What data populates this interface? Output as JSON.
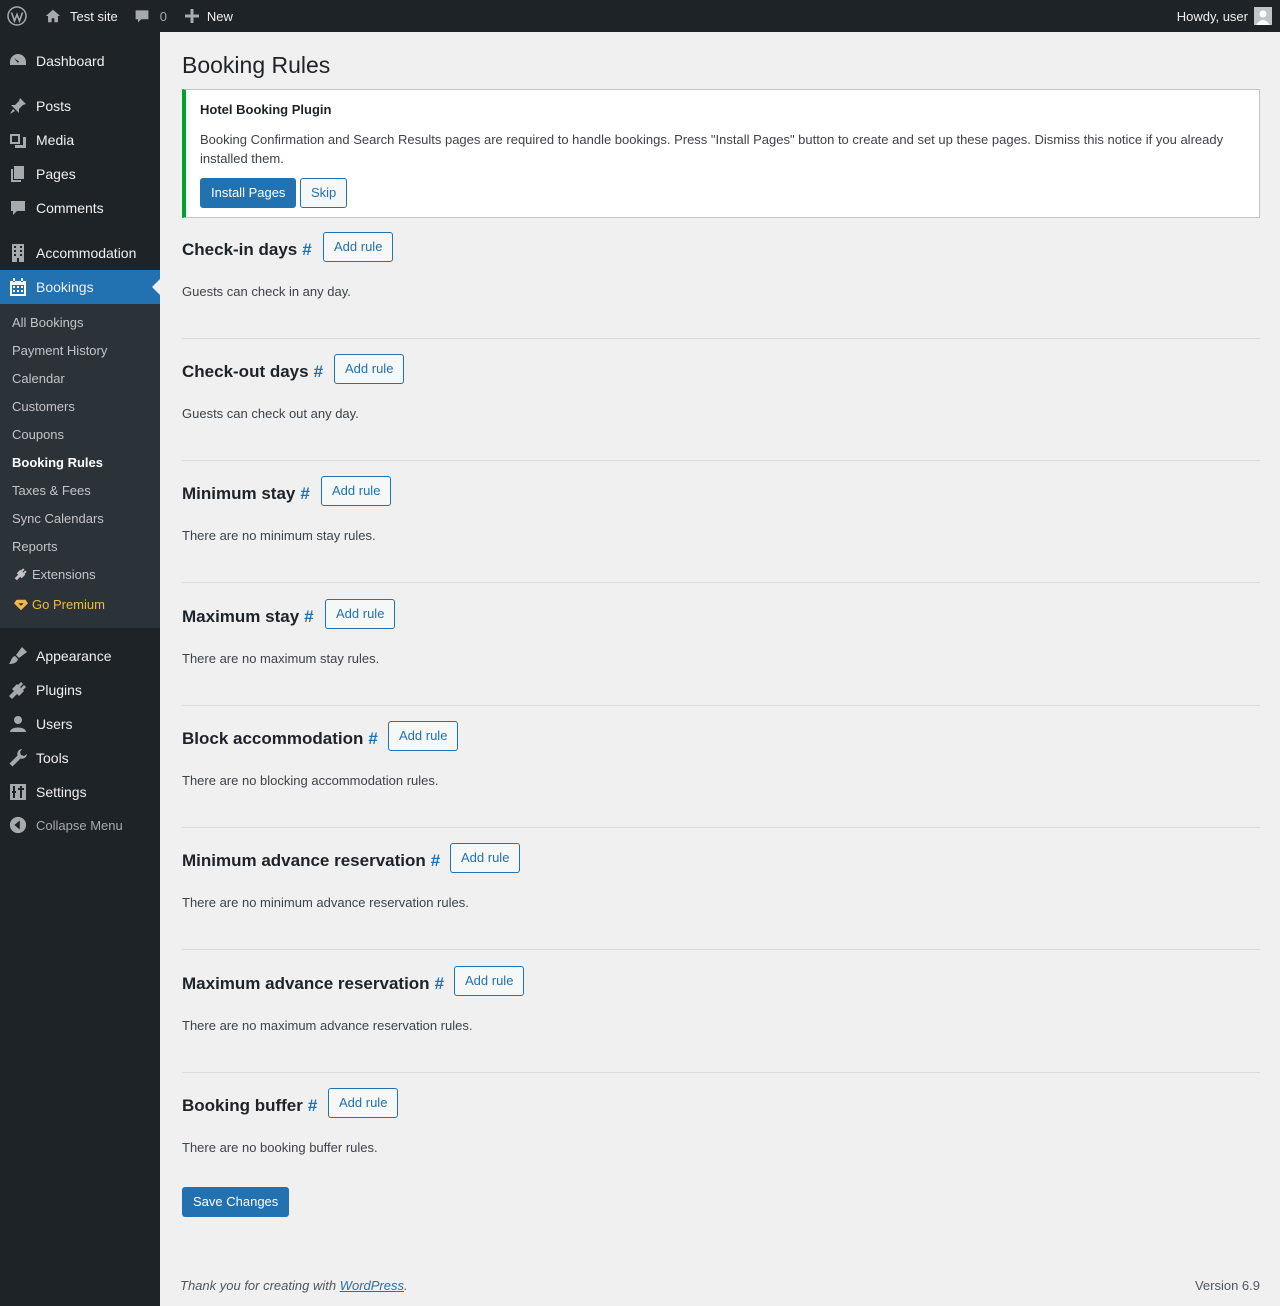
{
  "adminbar": {
    "site_name": "Test site",
    "comments_count": "0",
    "new_label": "New",
    "howdy": "Howdy, user"
  },
  "sidebar": {
    "items": [
      {
        "label": "Dashboard",
        "icon": "dashboard-icon"
      },
      {
        "label": "Posts",
        "icon": "pin-icon"
      },
      {
        "label": "Media",
        "icon": "media-icon"
      },
      {
        "label": "Pages",
        "icon": "pages-icon"
      },
      {
        "label": "Comments",
        "icon": "comment-icon"
      },
      {
        "label": "Accommodation",
        "icon": "building-icon"
      },
      {
        "label": "Bookings",
        "icon": "calendar-icon"
      },
      {
        "label": "Appearance",
        "icon": "brush-icon"
      },
      {
        "label": "Plugins",
        "icon": "plug-icon"
      },
      {
        "label": "Users",
        "icon": "user-icon"
      },
      {
        "label": "Tools",
        "icon": "wrench-icon"
      },
      {
        "label": "Settings",
        "icon": "settings-icon"
      }
    ],
    "submenu": [
      "All Bookings",
      "Payment History",
      "Calendar",
      "Customers",
      "Coupons",
      "Booking Rules",
      "Taxes & Fees",
      "Sync Calendars",
      "Reports",
      "Extensions",
      "Go Premium"
    ],
    "collapse_label": "Collapse Menu"
  },
  "page": {
    "title": "Booking Rules"
  },
  "notice": {
    "title": "Hotel Booking Plugin",
    "text": "Booking Confirmation and Search Results pages are required to handle bookings. Press \"Install Pages\" button to create and set up these pages. Dismiss this notice if you already installed them.",
    "install_label": "Install Pages",
    "skip_label": "Skip"
  },
  "sections": [
    {
      "title": "Check-in days",
      "text": "Guests can check in any day."
    },
    {
      "title": "Check-out days",
      "text": "Guests can check out any day."
    },
    {
      "title": "Minimum stay",
      "text": "There are no minimum stay rules."
    },
    {
      "title": "Maximum stay",
      "text": "There are no maximum stay rules."
    },
    {
      "title": "Block accommodation",
      "text": "There are no blocking accommodation rules."
    },
    {
      "title": "Minimum advance reservation",
      "text": "There are no minimum advance reservation rules."
    },
    {
      "title": "Maximum advance reservation",
      "text": "There are no maximum advance reservation rules."
    },
    {
      "title": "Booking buffer",
      "text": "There are no booking buffer rules."
    }
  ],
  "common": {
    "hash": "#",
    "add_rule": "Add rule",
    "save_label": "Save Changes"
  },
  "footer": {
    "thanks_prefix": "Thank you for creating with ",
    "wordpress_link": "WordPress",
    "thanks_suffix": ".",
    "version": "Version 6.9"
  },
  "colors": {
    "accent": "#2271b1",
    "notice_border": "#00a32a",
    "sidebar_bg": "#1d2327",
    "premium": "#f0b849"
  }
}
